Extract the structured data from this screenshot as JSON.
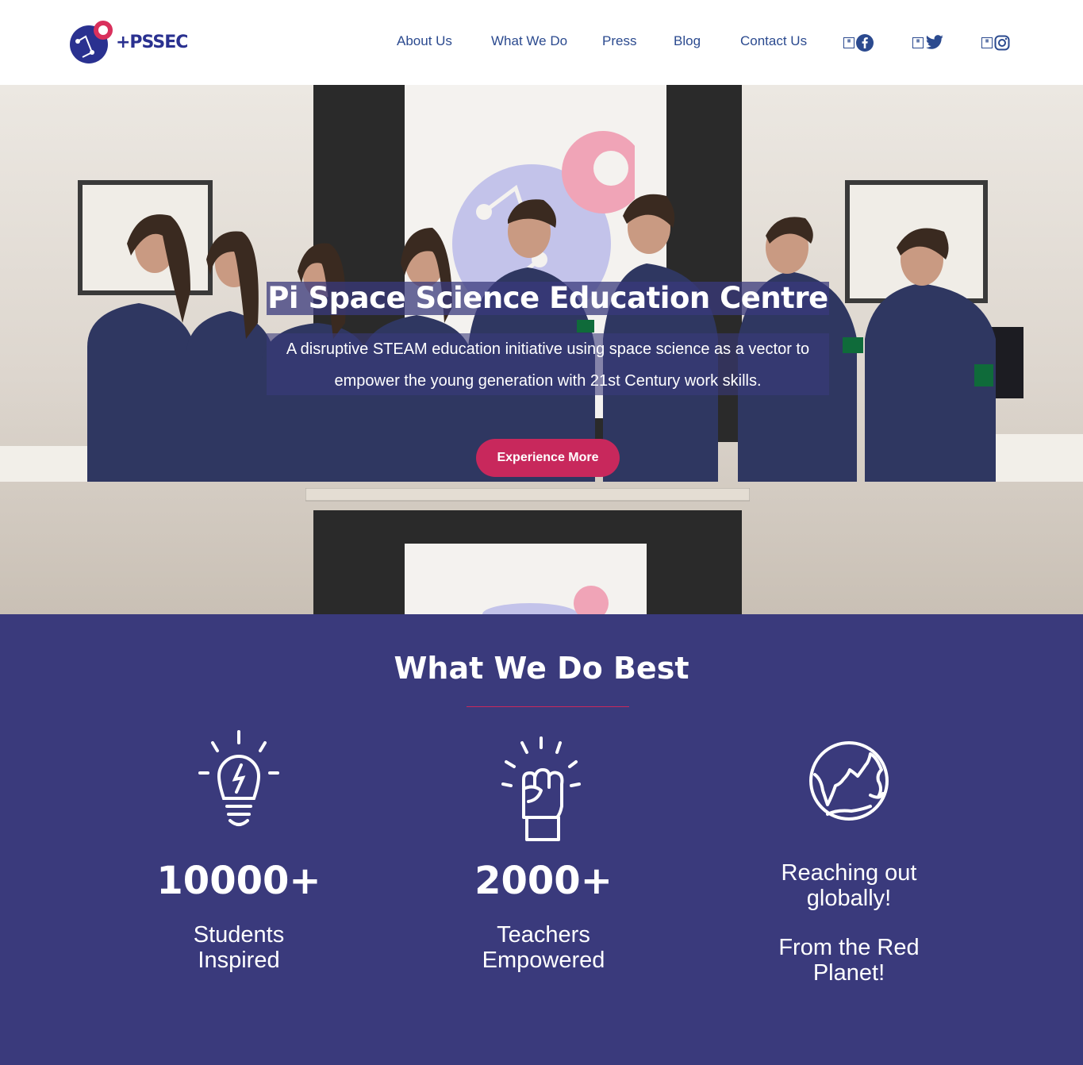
{
  "header": {
    "logo_text": "+PSSEC",
    "nav": [
      "About Us",
      "What We Do",
      "Press",
      "Blog",
      "Contact Us"
    ],
    "social": [
      "facebook-icon",
      "twitter-icon",
      "instagram-icon"
    ],
    "colors": {
      "nav": "#2b4a8f",
      "logo": "#2a3190",
      "logo_accent": "#d9305c"
    }
  },
  "hero": {
    "title": "Pi Space Science Education Centre",
    "subtitle": "A disruptive STEAM education initiative using space science as a vector to empower the young generation with 21st Century work skills.",
    "cta": "Experience More",
    "colors": {
      "cta": "#c8285c",
      "overlay": "#3a3a7c"
    }
  },
  "section": {
    "title": "What We Do Best",
    "items": [
      {
        "icon": "lightbulb-icon",
        "stat": "10000+",
        "label": "Students Inspired"
      },
      {
        "icon": "raised-fist-icon",
        "stat": "2000+",
        "label": "Teachers Empowered"
      },
      {
        "icon": "globe-icon",
        "label": "Reaching out globally!",
        "label2": "From the Red Planet!"
      }
    ],
    "colors": {
      "background": "#3a3a7c",
      "divider": "#c8285c"
    }
  }
}
